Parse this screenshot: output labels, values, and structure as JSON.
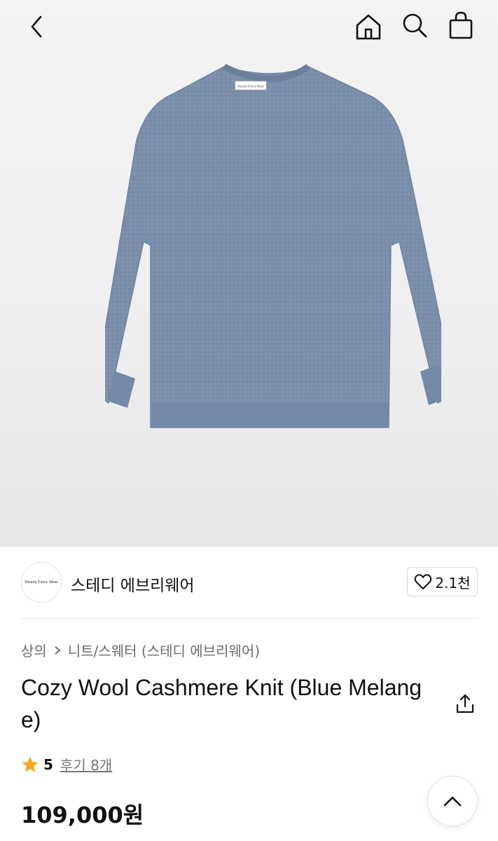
{
  "header": {
    "back_icon": "chevron-left-icon",
    "home_icon": "home-icon",
    "search_icon": "search-icon",
    "cart_icon": "shopping-bag-icon"
  },
  "product_image": {
    "label_text": "Steady Every Wear",
    "sweater_color": "#7b8fab"
  },
  "brand": {
    "logo_text": "Steady Every Wear",
    "name": "스테디 에브리웨어",
    "like_count": "2.1천"
  },
  "breadcrumb": {
    "category": "상의",
    "subcategory": "니트/스웨터 (스테디 에브리웨어)"
  },
  "product": {
    "title": "Cozy Wool Cashmere Knit (Blue Melange)",
    "rating": "5",
    "reviews_label": "후기 8개",
    "price": "109,000원"
  },
  "colors": {
    "star": "#f5a623",
    "text": "#111111",
    "muted": "#6b6b6b"
  }
}
